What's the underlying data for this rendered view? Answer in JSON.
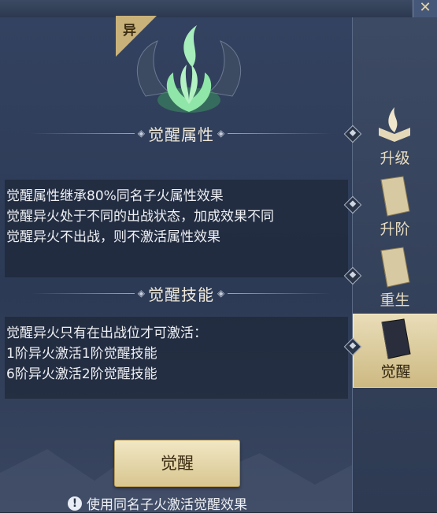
{
  "window": {
    "close_glyph": "✕"
  },
  "badge": {
    "label": "异"
  },
  "emblem": {
    "icon": "green-flame-lotus-icon"
  },
  "sections": [
    {
      "title": "觉醒属性",
      "lines": [
        "觉醒属性继承80%同名子火属性效果",
        "觉醒异火处于不同的出战状态，加成效果不同",
        "觉醒异火不出战，则不激活属性效果"
      ]
    },
    {
      "title": "觉醒技能",
      "lines": [
        "觉醒异火只有在出战位才可激活：",
        "1阶异火激活1阶觉醒技能",
        "6阶异火激活2阶觉醒技能"
      ]
    }
  ],
  "awaken_button": {
    "label": "觉醒"
  },
  "tip": {
    "icon": "!",
    "text": "使用同名子火激活觉醒效果"
  },
  "sidebar": {
    "tabs": [
      {
        "label": "升级",
        "icon": "flame-book-icon",
        "active": false
      },
      {
        "label": "升阶",
        "icon": "book-icon",
        "active": false
      },
      {
        "label": "重生",
        "icon": "book-icon",
        "active": false
      },
      {
        "label": "觉醒",
        "icon": "dark-book-icon",
        "active": true
      }
    ]
  },
  "colors": {
    "accent_gold": "#d8c690",
    "panel": "#2c3a55",
    "flame_green": "#7fe3a0"
  }
}
